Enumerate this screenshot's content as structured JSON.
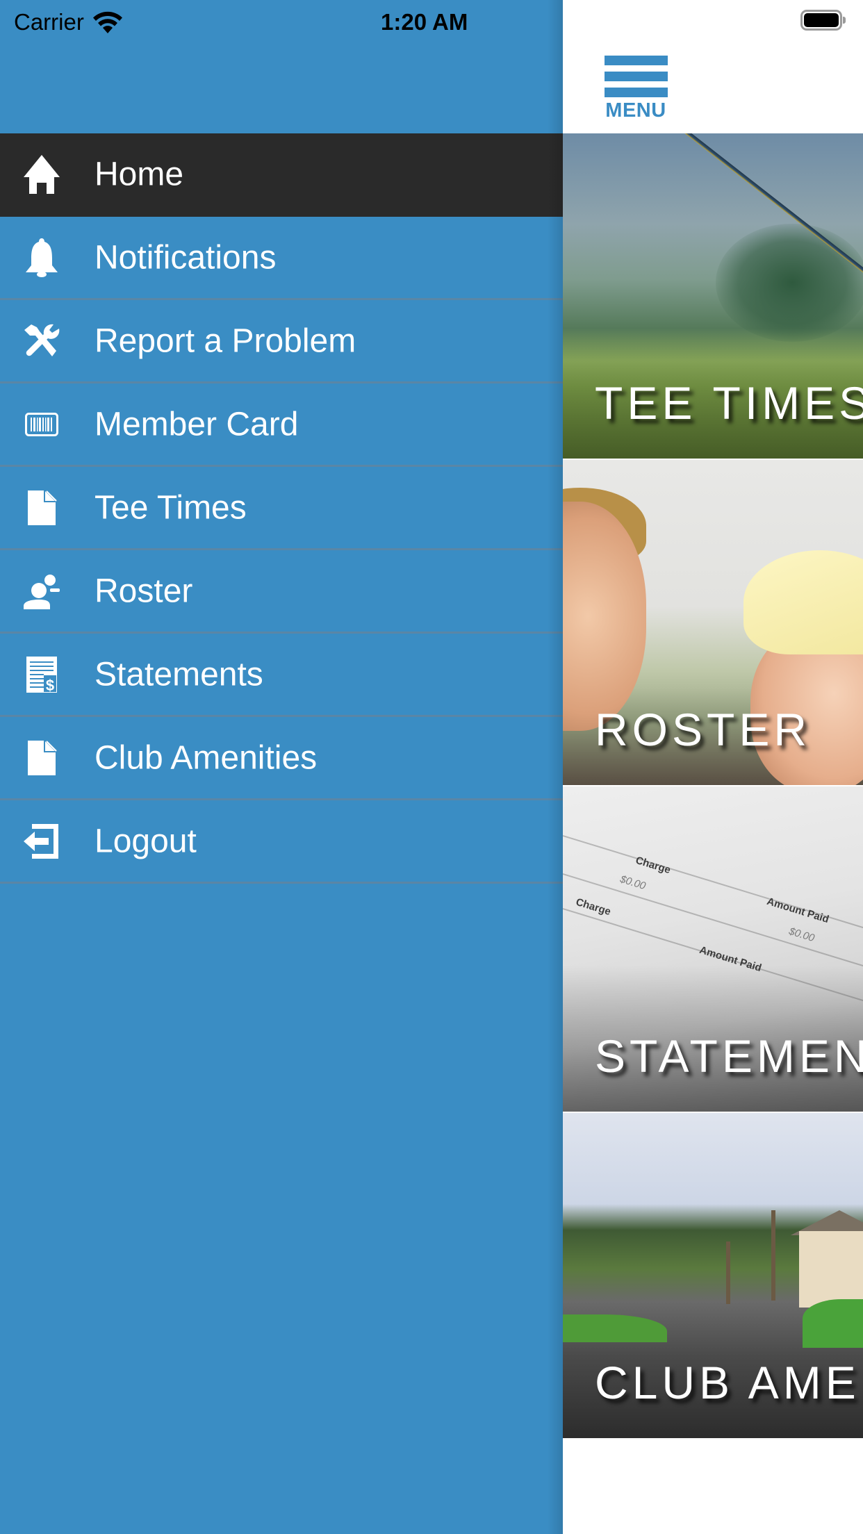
{
  "status_bar": {
    "carrier": "Carrier",
    "time": "1:20 AM",
    "wifi_icon": "wifi-icon",
    "battery_icon": "battery-full-icon",
    "battery_level": 1.0
  },
  "colors": {
    "drawer_bg": "#3a8dc4",
    "active_item_bg": "#2a2a2a",
    "separator": "#5a86a6",
    "menu_accent": "#3a8cc4",
    "text": "#ffffff"
  },
  "drawer": {
    "active_index": 0,
    "items": [
      {
        "label": "Home",
        "icon": "home-icon"
      },
      {
        "label": "Notifications",
        "icon": "bell-icon"
      },
      {
        "label": "Report a Problem",
        "icon": "tools-icon"
      },
      {
        "label": "Member Card",
        "icon": "barcode-icon"
      },
      {
        "label": "Tee Times",
        "icon": "document-icon"
      },
      {
        "label": "Roster",
        "icon": "users-icon"
      },
      {
        "label": "Statements",
        "icon": "statement-dollar-icon"
      },
      {
        "label": "Club Amenities",
        "icon": "document-icon"
      },
      {
        "label": "Logout",
        "icon": "logout-icon"
      }
    ]
  },
  "header": {
    "menu_label": "MENU",
    "menu_icon": "hamburger-icon"
  },
  "tiles": [
    {
      "label": "TEE TIMES"
    },
    {
      "label": "ROSTER"
    },
    {
      "label": "STATEMENTS"
    },
    {
      "label": "CLUB AMENITIES"
    }
  ],
  "statement_image_text": {
    "charge": "Charge",
    "amount_paid": "Amount Paid",
    "zero": "$0.00"
  }
}
